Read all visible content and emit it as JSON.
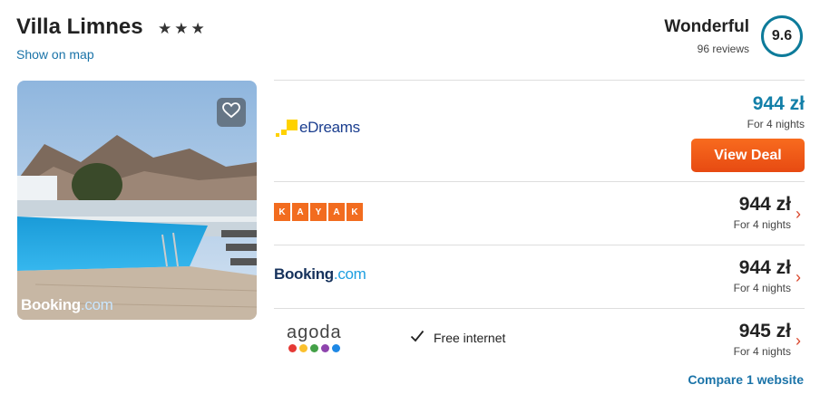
{
  "hotel": {
    "name": "Villa Limnes",
    "stars": "★★★",
    "map_link": "Show on map"
  },
  "rating": {
    "word": "Wonderful",
    "reviews": "96 reviews",
    "score": "9.6",
    "accent_color": "#0d7b9a"
  },
  "photo": {
    "watermark_brand": "Booking",
    "watermark_tld": ".com",
    "favorite_icon": "heart-icon"
  },
  "offers": [
    {
      "provider": "eDreams",
      "price": "944 zł",
      "nights": "For 4 nights",
      "button": "View Deal",
      "price_color": "#127fa8"
    },
    {
      "provider": "KAYAK",
      "letters": [
        "K",
        "A",
        "Y",
        "A",
        "K"
      ],
      "price": "944 zł",
      "nights": "For 4 nights"
    },
    {
      "provider_brand": "Booking",
      "provider_tld": ".com",
      "price": "944 zł",
      "nights": "For 4 nights"
    },
    {
      "provider": "agoda",
      "amenity": "Free internet",
      "price": "945 zł",
      "nights": "For 4 nights"
    }
  ],
  "footer": {
    "compare": "Compare 1 website"
  },
  "colors": {
    "deal_button": "#f0571a",
    "link": "#1a73a8",
    "chevron": "#d9462b"
  }
}
